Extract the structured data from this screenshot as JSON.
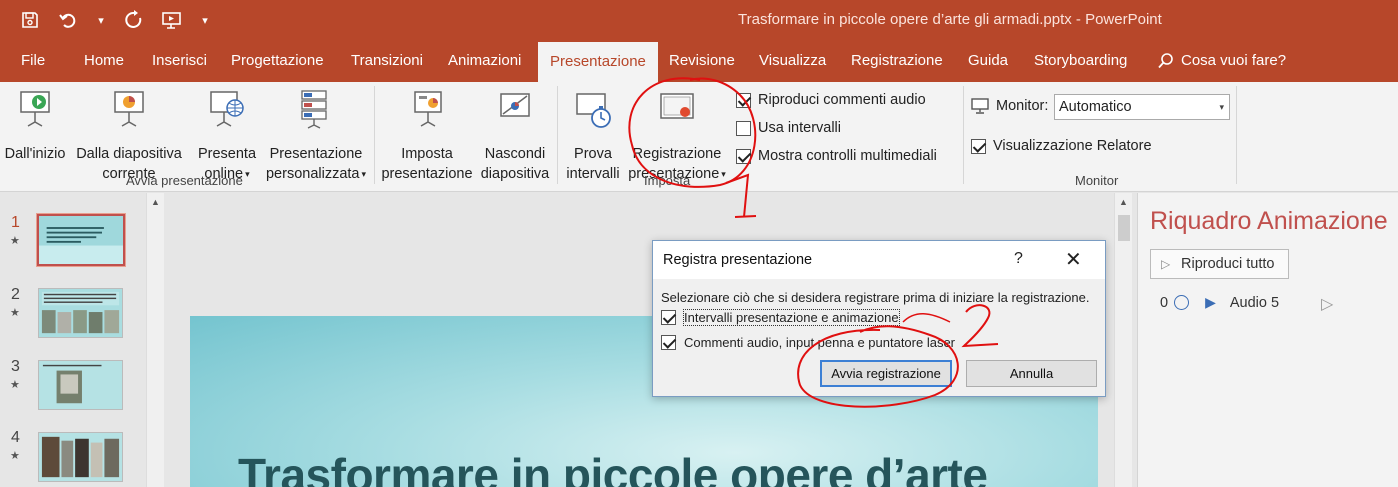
{
  "window": {
    "title": "Trasformare in piccole opere d’arte gli armadi.pptx  -  PowerPoint"
  },
  "quick_access": {
    "icons": [
      "save-icon",
      "undo-icon",
      "undo-dropdown-icon",
      "redo-icon",
      "start-from-beginning-icon",
      "customize-qat-icon"
    ]
  },
  "tabs": [
    {
      "label": "File"
    },
    {
      "label": "Home"
    },
    {
      "label": "Inserisci"
    },
    {
      "label": "Progettazione"
    },
    {
      "label": "Transizioni"
    },
    {
      "label": "Animazioni"
    },
    {
      "label": "Presentazione"
    },
    {
      "label": "Revisione"
    },
    {
      "label": "Visualizza"
    },
    {
      "label": "Registrazione"
    },
    {
      "label": "Guida"
    },
    {
      "label": "Storyboarding"
    }
  ],
  "tell_me": "Cosa vuoi fare?",
  "ribbon": {
    "avvia": {
      "label": "Avvia presentazione",
      "from_start": "Dall'inizio",
      "from_current_1": "Dalla diapositiva",
      "from_current_2": "corrente",
      "online_1": "Presenta",
      "online_2": "online",
      "custom_1": "Presentazione",
      "custom_2": "personalizzata"
    },
    "imposta": {
      "label": "Imposta",
      "setup_1": "Imposta",
      "setup_2": "presentazione",
      "hide_1": "Nascondi",
      "hide_2": "diapositiva",
      "rehearse_1": "Prova",
      "rehearse_2": "intervalli",
      "record_1": "Registrazione",
      "record_2": "presentazione",
      "play_narrations": "Riproduci commenti audio",
      "use_timings": "Usa intervalli",
      "show_media": "Mostra controlli multimediali"
    },
    "monitor": {
      "label": "Monitor",
      "monitor_label": "Monitor:",
      "monitor_value": "Automatico",
      "presenter_view": "Visualizzazione Relatore"
    }
  },
  "thumbnails": [
    {
      "num": "1"
    },
    {
      "num": "2"
    },
    {
      "num": "3"
    },
    {
      "num": "4"
    }
  ],
  "slide": {
    "title": "Trasformare in piccole opere d’arte"
  },
  "animation_pane": {
    "title": "Riquadro Animazione",
    "play_all": "Riproduci tutto",
    "item_delay": "0",
    "item_label": "Audio 5"
  },
  "dialog": {
    "title": "Registra presentazione",
    "help": "?",
    "description": "Selezionare ciò che si desidera registrare prima di iniziare la registrazione.",
    "opt_timings": "Intervalli presentazione e animazione",
    "opt_narrations": "Commenti audio, input penna e puntatore laser",
    "start_button": "Avvia registrazione",
    "cancel_button": "Annulla"
  },
  "annotations": {
    "label_1": "1",
    "label_2": "2"
  }
}
